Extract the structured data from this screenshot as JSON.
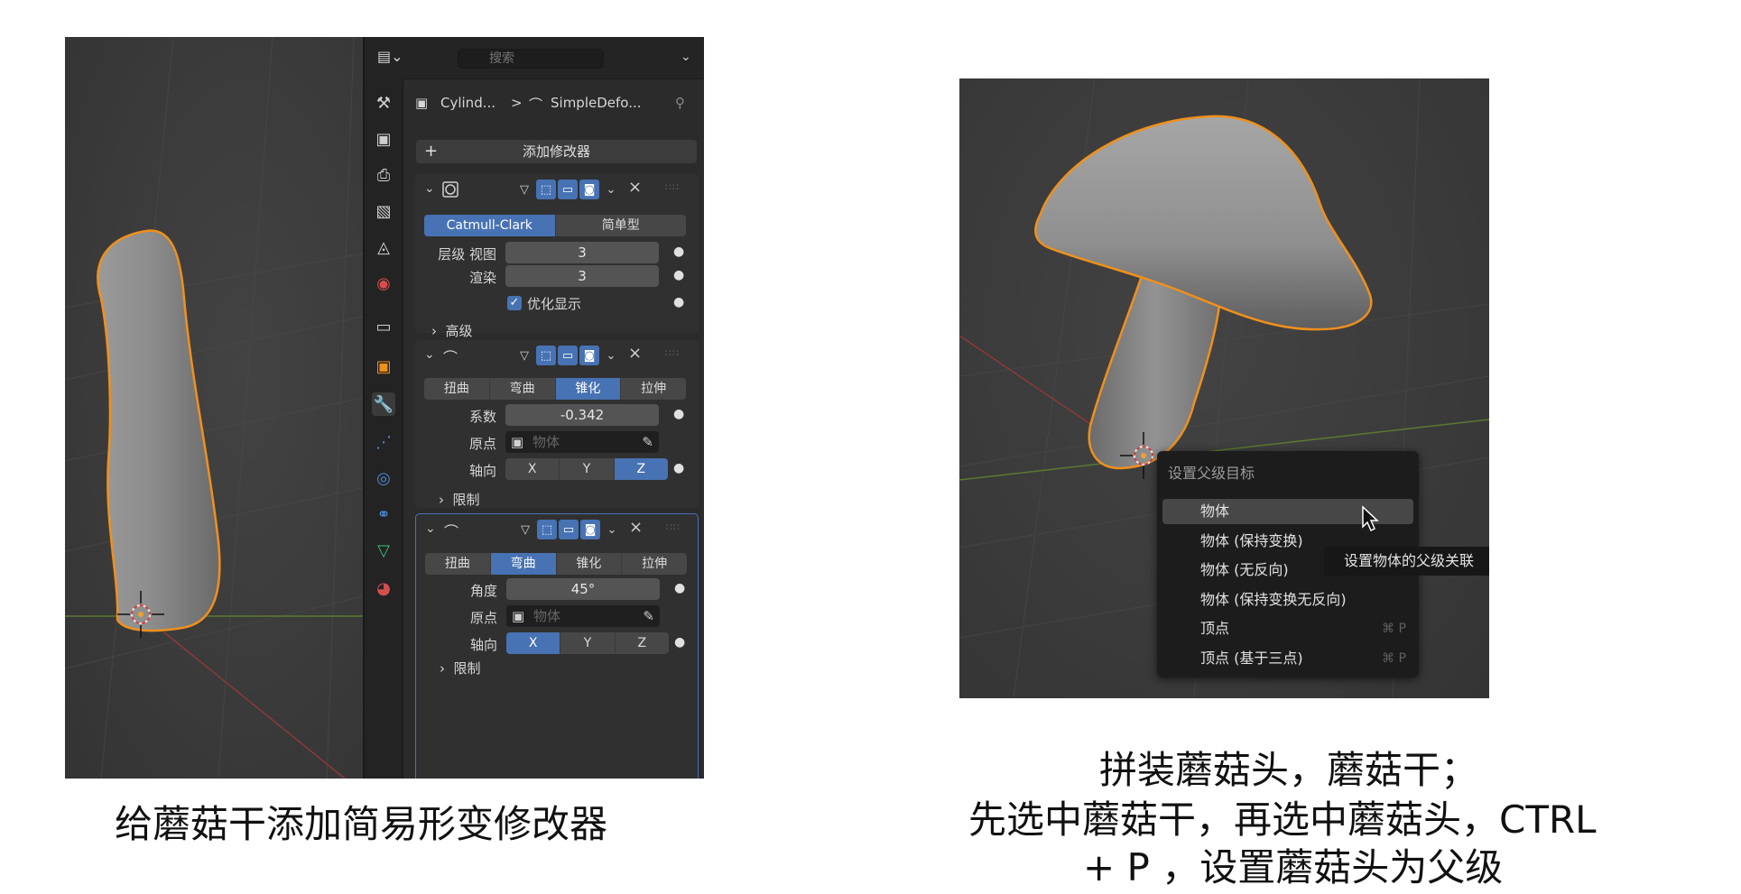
{
  "colors": {
    "accent_blue": "#4772b3",
    "selection_orange": "#f0901c",
    "panel_bg": "#2b2b2b",
    "viewport_bg": "#3d3d3d"
  },
  "left_viewport": {
    "object": "mushroom-stem",
    "cursor_icon": "3d-cursor-icon"
  },
  "properties_panel": {
    "search_placeholder": "搜索",
    "editor_type_icon": "editor-type-icon",
    "breadcrumb": {
      "object": "Cylind...",
      "separator": ">",
      "modifier": "SimpleDefo..."
    },
    "add_modifier_label": "添加修改器",
    "tabs": [
      "tool-icon",
      "render-icon",
      "output-icon",
      "view-layer-icon",
      "scene-icon",
      "world-icon",
      "collection-icon",
      "object-icon",
      "modifier-icon",
      "particles-icon",
      "physics-icon",
      "constraints-icon",
      "data-icon",
      "material-icon"
    ],
    "subsurf": {
      "modes": [
        "Catmull-Clark",
        "简单型"
      ],
      "active_mode": 0,
      "levels_viewport_label": "层级 视图",
      "levels_viewport_value": "3",
      "render_label": "渲染",
      "render_value": "3",
      "optimal_display_label": "优化显示",
      "optimal_display_checked": true,
      "advanced_label": "高级"
    },
    "deform1": {
      "modes": [
        "扭曲",
        "弯曲",
        "锥化",
        "拉伸"
      ],
      "active_mode": 2,
      "factor_label": "系数",
      "factor_value": "-0.342",
      "origin_label": "原点",
      "origin_placeholder": "物体",
      "axis_label": "轴向",
      "axes": [
        "X",
        "Y",
        "Z"
      ],
      "active_axis": 2,
      "limits_label": "限制"
    },
    "deform2": {
      "modes": [
        "扭曲",
        "弯曲",
        "锥化",
        "拉伸"
      ],
      "active_mode": 1,
      "angle_label": "角度",
      "angle_value": "45°",
      "origin_label": "原点",
      "origin_placeholder": "物体",
      "axis_label": "轴向",
      "axes": [
        "X",
        "Y",
        "Z"
      ],
      "active_axis": 0,
      "limits_label": "限制"
    }
  },
  "right_viewport": {
    "object": "mushroom",
    "context_menu": {
      "title": "设置父级目标",
      "items": [
        {
          "label": "物体",
          "shortcut": ""
        },
        {
          "label": "物体 (保持变换)",
          "shortcut": ""
        },
        {
          "label": "物体 (无反向)",
          "shortcut": ""
        },
        {
          "label": "物体 (保持变换无反向)",
          "shortcut": ""
        },
        {
          "label": "顶点",
          "shortcut": "⌘ P"
        },
        {
          "label": "顶点 (基于三点)",
          "shortcut": "⌘ P"
        }
      ],
      "highlighted": 0
    },
    "tooltip": "设置物体的父级关联"
  },
  "captions": {
    "left": "给蘑菇干添加简易形变修改器",
    "right_line1": "拼装蘑菇头，蘑菇干；",
    "right_line2": "先选中蘑菇干，再选中蘑菇头，CTRL",
    "right_line3": "+ P ，设置蘑菇头为父级"
  }
}
